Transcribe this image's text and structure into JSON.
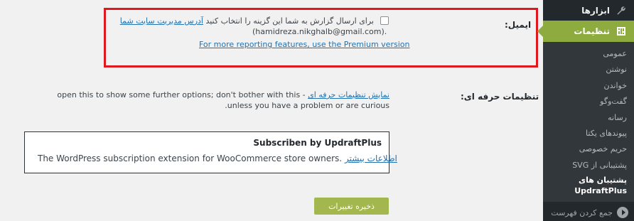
{
  "sidebar": {
    "tools_label": "ابزارها",
    "settings_label": "تنظیمات",
    "items": [
      {
        "label": "عمومی"
      },
      {
        "label": "نوشتن"
      },
      {
        "label": "خواندن"
      },
      {
        "label": "گفت‌وگو"
      },
      {
        "label": "رسانه"
      },
      {
        "label": "پیوندهای یکتا"
      },
      {
        "label": "حریم خصوصی"
      },
      {
        "label": "پشتیبانی از SVG"
      },
      {
        "label": "پشتیبان های UpdraftPlus"
      }
    ],
    "collapse_label": "جمع کردن فهرست"
  },
  "email": {
    "label": "ایمیل:",
    "line1_text": "برای ارسال گزارش به شما این گزینه را انتخاب کنید",
    "line1_link": "آدرس مدیریت سایت شما",
    "line2": "(hamidreza.nikghalb@gmail.com).",
    "premium_link": "For more reporting features, use the Premium version"
  },
  "expert": {
    "label": "تنظیمات حرفه ای:",
    "link": "نمایش تنظیمات حرفه ای",
    "text": "- open this to show some further options; don't bother with this unless you have a problem or are curious."
  },
  "promo": {
    "title": "Subscriben by UpdraftPlus",
    "body": "The WordPress subscription extension for WooCommerce store owners.",
    "link": "اطلاعات بیشتر"
  },
  "save_button": "ذخیره تغییرات",
  "colors": {
    "sidebar_bg": "#23282d",
    "accent": "#8dab3f",
    "highlight_border": "#e0171f",
    "link": "#2271b1"
  }
}
